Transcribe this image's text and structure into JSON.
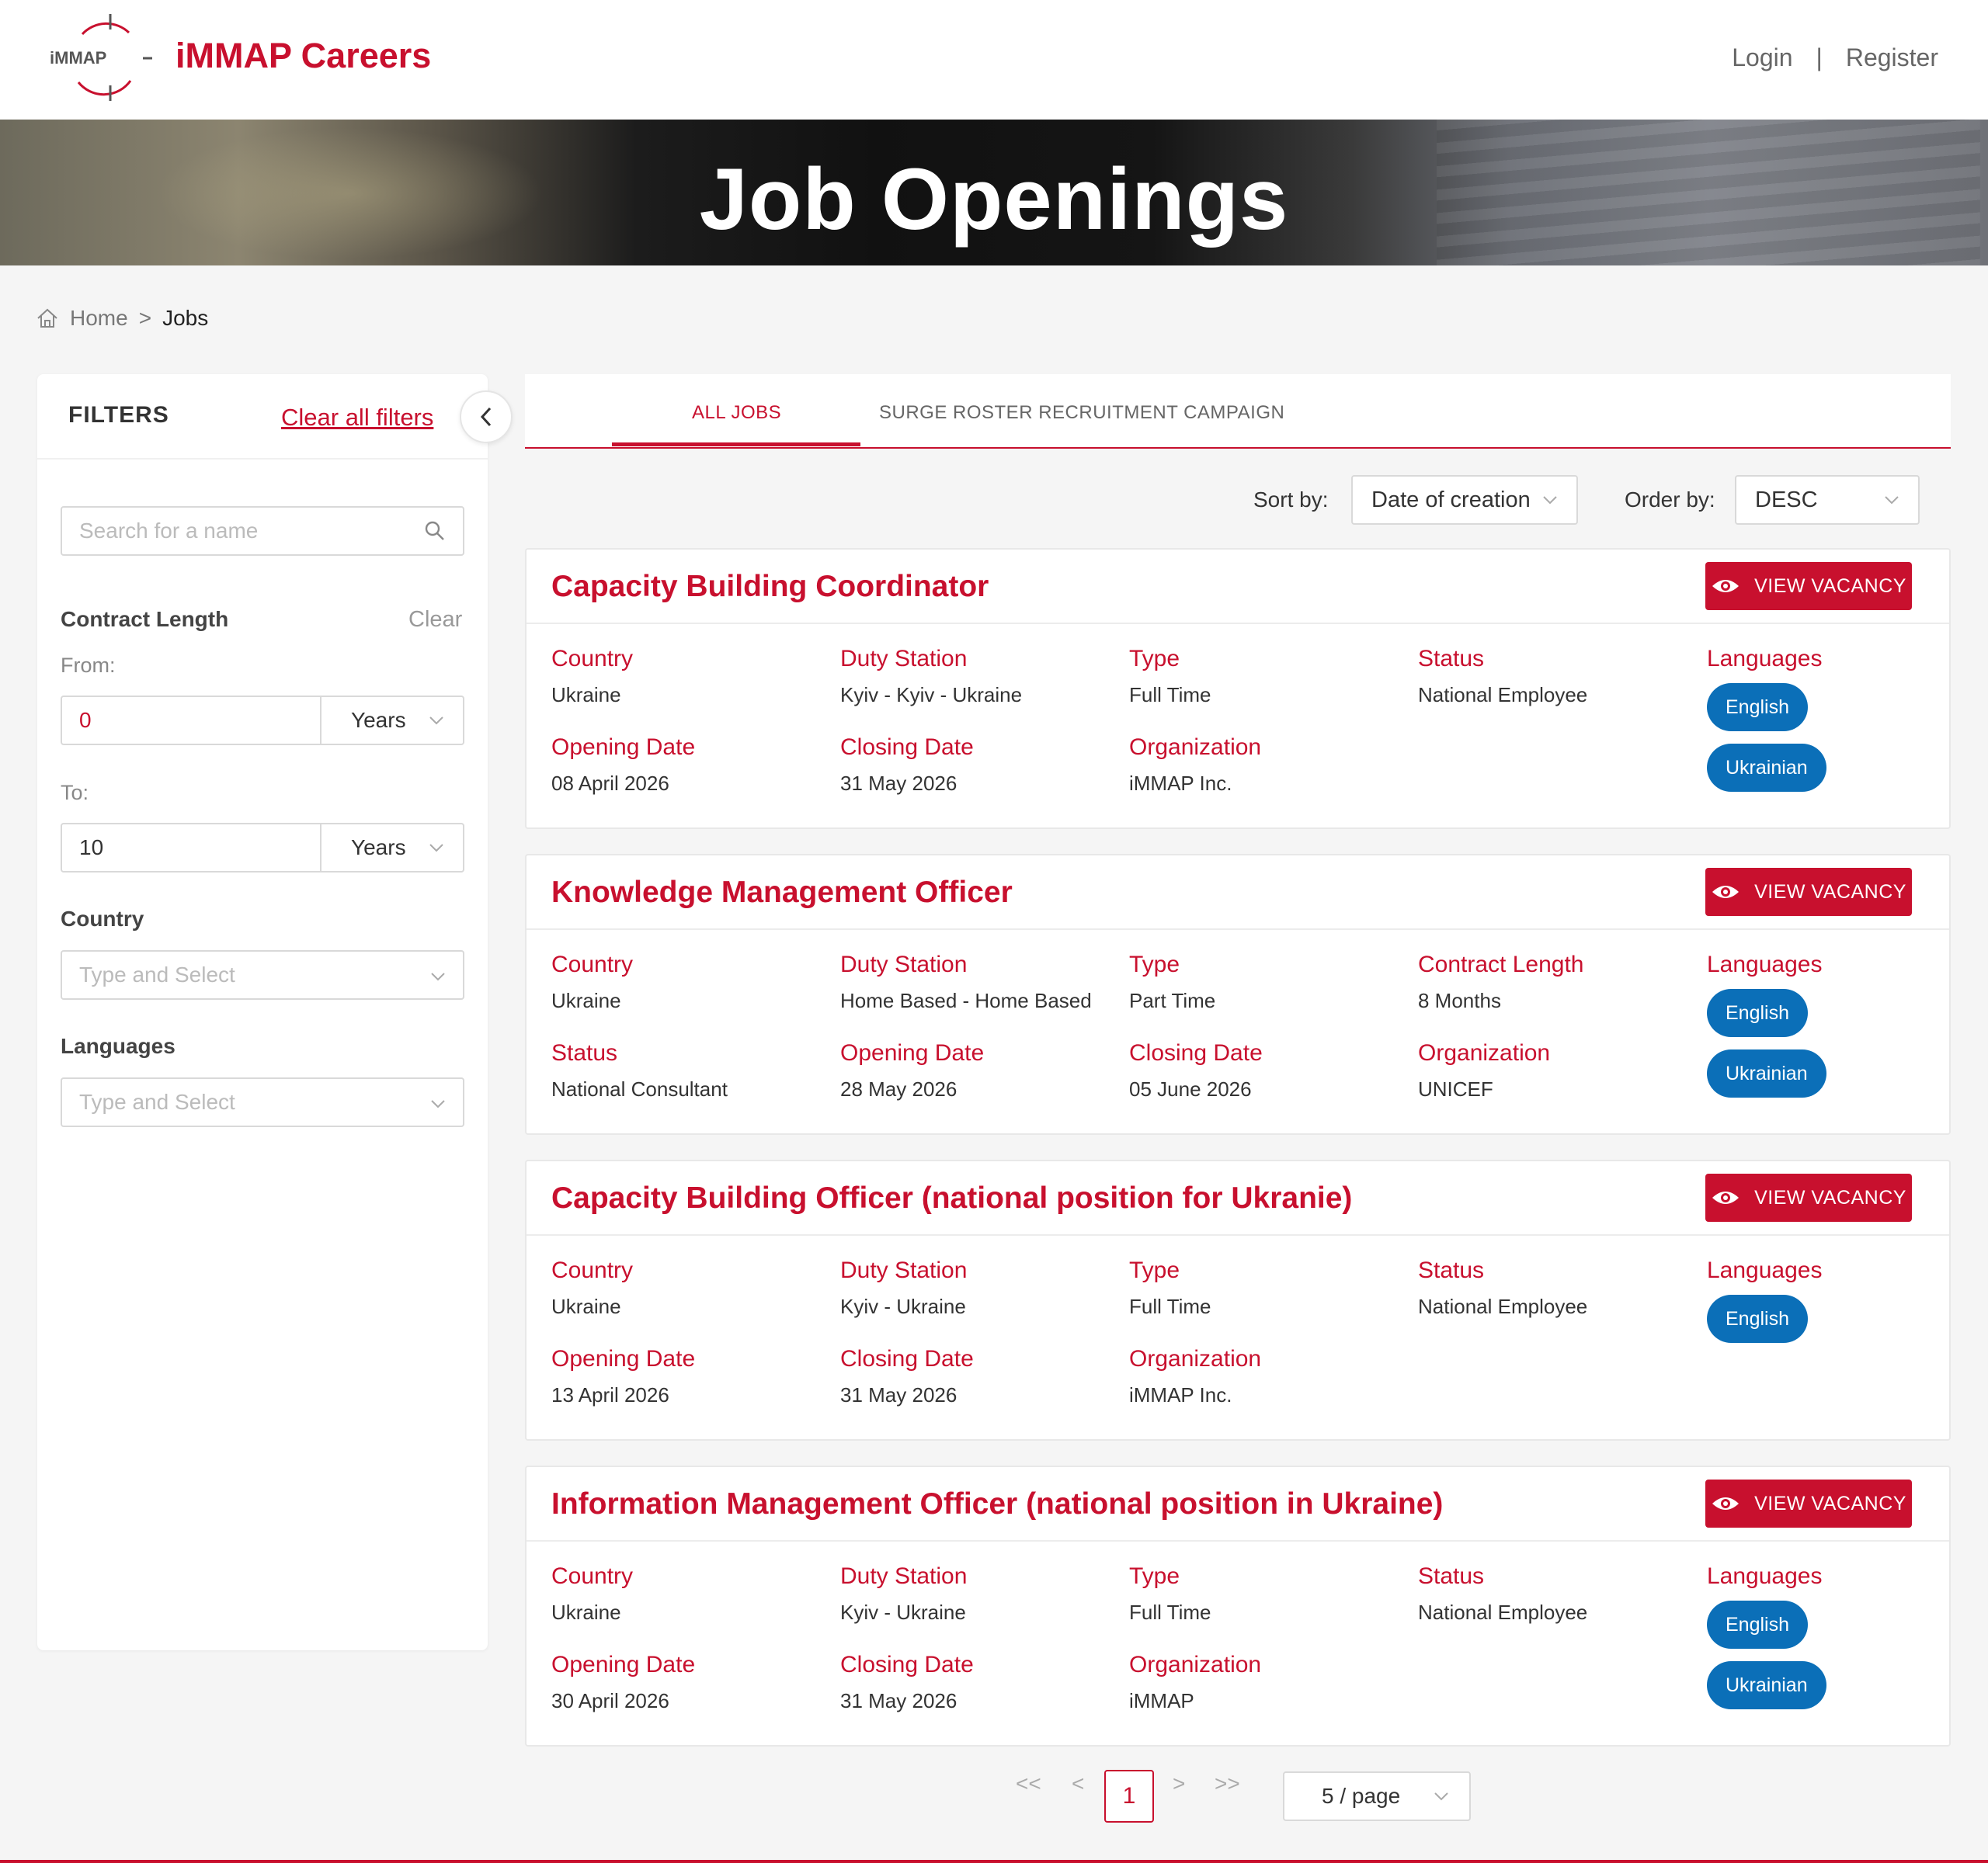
{
  "header": {
    "logo_text": "iMMAP",
    "brand": "iMMAP Careers",
    "login": "Login",
    "separator": "|",
    "register": "Register"
  },
  "hero": {
    "title": "Job Openings"
  },
  "breadcrumb": {
    "home": "Home",
    "sep": ">",
    "current": "Jobs"
  },
  "filters": {
    "title": "FILTERS",
    "clear_all": "Clear all filters",
    "search_placeholder": "Search for a name",
    "contract_length": {
      "label": "Contract Length",
      "clear": "Clear",
      "from_label": "From:",
      "from_value": "0",
      "from_unit": "Years",
      "to_label": "To:",
      "to_value": "10",
      "to_unit": "Years"
    },
    "country": {
      "label": "Country",
      "placeholder": "Type and Select"
    },
    "languages": {
      "label": "Languages",
      "placeholder": "Type and Select"
    }
  },
  "tabs": [
    {
      "label": "ALL JOBS",
      "active": true
    },
    {
      "label": "SURGE ROSTER RECRUITMENT CAMPAIGN",
      "active": false
    }
  ],
  "sort": {
    "sort_label": "Sort by:",
    "sort_value": "Date of creation",
    "order_label": "Order by:",
    "order_value": "DESC"
  },
  "view_vacancy_label": "VIEW VACANCY",
  "jobs": [
    {
      "title": "Capacity Building Coordinator",
      "fields": [
        {
          "label": "Country",
          "value": "Ukraine"
        },
        {
          "label": "Duty Station",
          "value": "Kyiv - Kyiv - Ukraine"
        },
        {
          "label": "Type",
          "value": "Full Time"
        },
        {
          "label": "Status",
          "value": "National Employee"
        },
        {
          "label": "Opening Date",
          "value": "08 April 2026"
        },
        {
          "label": "Closing Date",
          "value": "31 May 2026"
        },
        {
          "label": "Organization",
          "value": "iMMAP Inc."
        }
      ],
      "languages_label": "Languages",
      "languages": [
        "English",
        "Ukrainian"
      ]
    },
    {
      "title": "Knowledge Management Officer",
      "fields": [
        {
          "label": "Country",
          "value": "Ukraine"
        },
        {
          "label": "Duty Station",
          "value": "Home Based - Home Based"
        },
        {
          "label": "Type",
          "value": "Part Time"
        },
        {
          "label": "Contract Length",
          "value": "8 Months"
        },
        {
          "label": "Status",
          "value": "National Consultant"
        },
        {
          "label": "Opening Date",
          "value": "28 May 2026"
        },
        {
          "label": "Closing Date",
          "value": "05 June 2026"
        },
        {
          "label": "Organization",
          "value": "UNICEF"
        }
      ],
      "languages_label": "Languages",
      "languages": [
        "English",
        "Ukrainian"
      ]
    },
    {
      "title": "Capacity Building Officer (national position for Ukranie)",
      "fields": [
        {
          "label": "Country",
          "value": "Ukraine"
        },
        {
          "label": "Duty Station",
          "value": "Kyiv - Ukraine"
        },
        {
          "label": "Type",
          "value": "Full Time"
        },
        {
          "label": "Status",
          "value": "National Employee"
        },
        {
          "label": "Opening Date",
          "value": "13 April 2026"
        },
        {
          "label": "Closing Date",
          "value": "31 May 2026"
        },
        {
          "label": "Organization",
          "value": "iMMAP Inc."
        }
      ],
      "languages_label": "Languages",
      "languages": [
        "English"
      ]
    },
    {
      "title": "Information Management Officer (national position in Ukraine)",
      "fields": [
        {
          "label": "Country",
          "value": "Ukraine"
        },
        {
          "label": "Duty Station",
          "value": "Kyiv - Ukraine"
        },
        {
          "label": "Type",
          "value": "Full Time"
        },
        {
          "label": "Status",
          "value": "National Employee"
        },
        {
          "label": "Opening Date",
          "value": "30 April 2026"
        },
        {
          "label": "Closing Date",
          "value": "31 May 2026"
        },
        {
          "label": "Organization",
          "value": "iMMAP"
        }
      ],
      "languages_label": "Languages",
      "languages": [
        "English",
        "Ukrainian"
      ]
    }
  ],
  "pagination": {
    "first": "<<",
    "prev": "<",
    "current": "1",
    "next": ">",
    "last": ">>",
    "per_page": "5 / page"
  },
  "colors": {
    "accent": "#c8102e",
    "pill": "#0b6fb8"
  },
  "icons": [
    "home-icon",
    "search-icon",
    "chevron-left-icon",
    "chevron-down-icon",
    "eye-icon"
  ]
}
